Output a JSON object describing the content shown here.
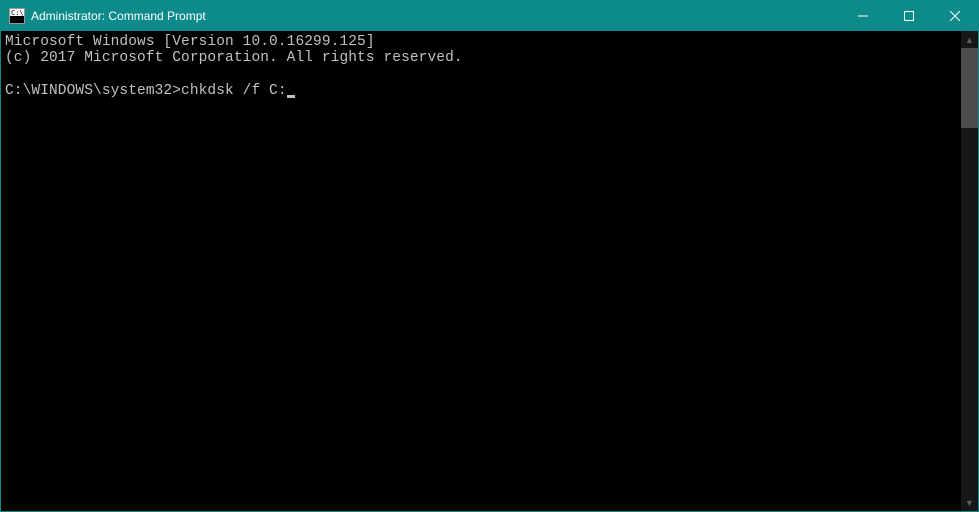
{
  "window": {
    "title": "Administrator: Command Prompt"
  },
  "terminal": {
    "line1": "Microsoft Windows [Version 10.0.16299.125]",
    "line2": "(c) 2017 Microsoft Corporation. All rights reserved.",
    "blank": "",
    "prompt": "C:\\WINDOWS\\system32>",
    "command": "chkdsk /f C:"
  },
  "scrollbar": {
    "up": "▲",
    "down": "▼"
  }
}
